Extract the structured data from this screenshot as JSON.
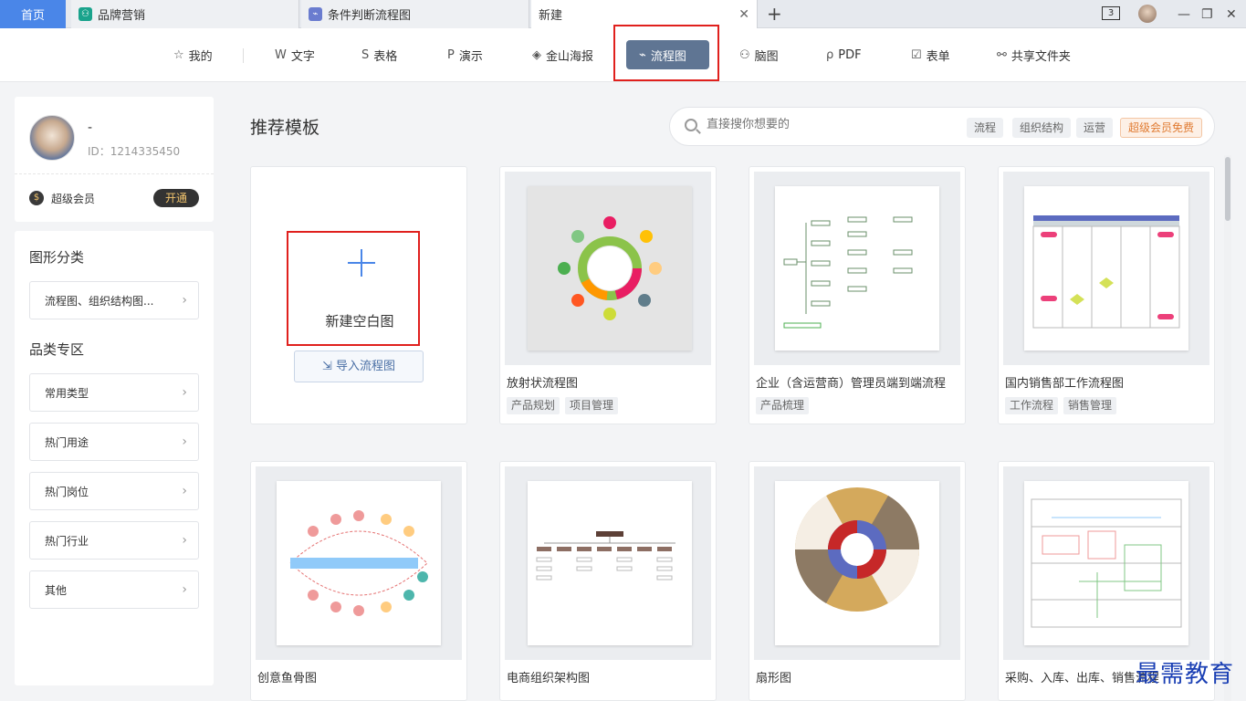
{
  "tabs": {
    "home": "首页",
    "items": [
      "品牌营销",
      "条件判断流程图",
      "新建"
    ]
  },
  "window": {
    "badge": "3"
  },
  "nav": {
    "items": [
      "我的",
      "文字",
      "表格",
      "演示",
      "金山海报",
      "流程图",
      "脑图",
      "PDF",
      "表单",
      "共享文件夹"
    ],
    "icons": [
      "☆",
      "W",
      "S",
      "P",
      "◈",
      "⌁",
      "⚇",
      "ρ",
      "☑",
      "⚯"
    ],
    "active_index": 5
  },
  "profile": {
    "name": "-",
    "id": "ID：1214335450",
    "vip_label": "超级会员",
    "vip_button": "开通"
  },
  "sidebar": {
    "section1_title": "图形分类",
    "section1_items": [
      "流程图、组织结构图..."
    ],
    "section2_title": "品类专区",
    "section2_items": [
      "常用类型",
      "热门用途",
      "热门岗位",
      "热门行业",
      "其他"
    ]
  },
  "main": {
    "title": "推荐模板",
    "search_placeholder": "直接搜你想要的",
    "chips": [
      "流程",
      "组织结构",
      "运营",
      "超级会员免费"
    ],
    "new_blank": "新建空白图",
    "import": "导入流程图",
    "templates": [
      {
        "name": "放射状流程图",
        "tags": [
          "产品规划",
          "项目管理"
        ]
      },
      {
        "name": "企业（含运营商）管理员端到端流程",
        "tags": [
          "产品梳理"
        ]
      },
      {
        "name": "国内销售部工作流程图",
        "tags": [
          "工作流程",
          "销售管理"
        ]
      },
      {
        "name": "创意鱼骨图",
        "tags": []
      },
      {
        "name": "电商组织架构图",
        "tags": []
      },
      {
        "name": "扇形图",
        "tags": []
      },
      {
        "name": "采购、入库、出库、销售流程",
        "tags": []
      }
    ]
  },
  "watermark": "最需教育",
  "colors": {
    "accent": "#4a86e8",
    "nav_active": "#5f7593",
    "highlight": "#e0201d",
    "vip": "#e07b32"
  }
}
